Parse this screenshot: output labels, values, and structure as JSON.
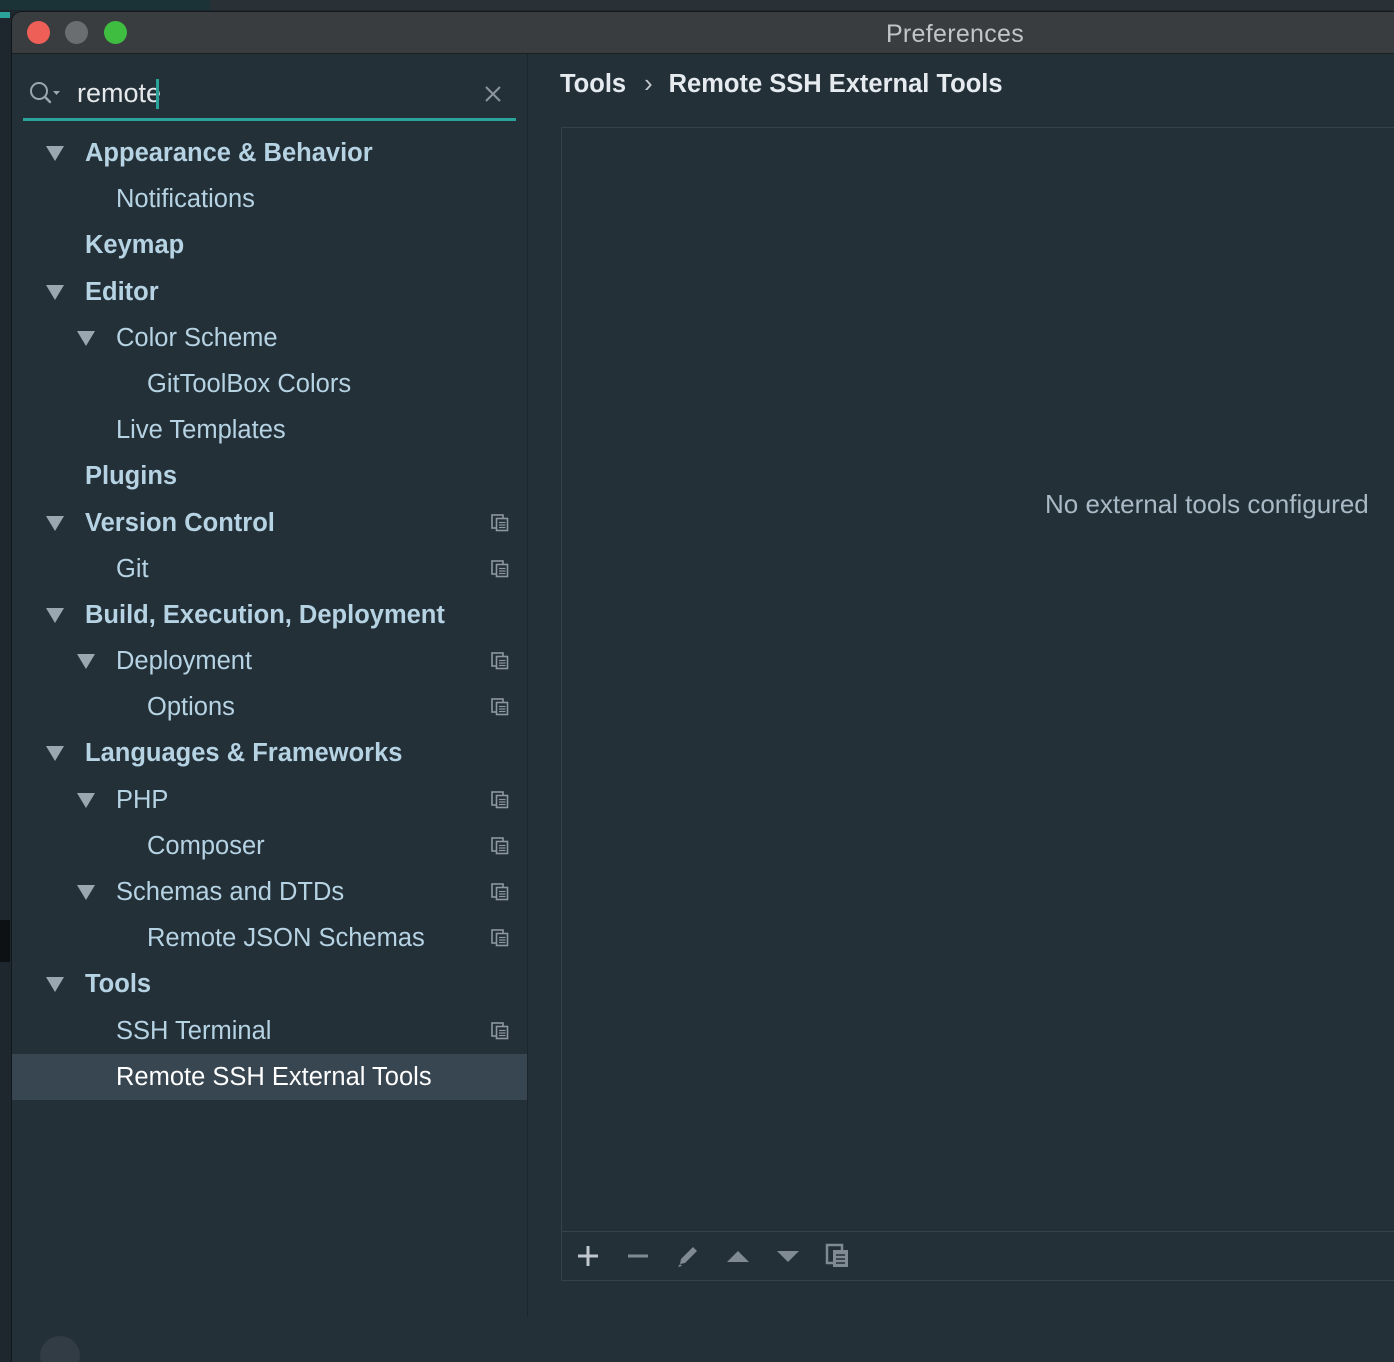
{
  "window": {
    "title": "Preferences"
  },
  "search": {
    "value": "remote",
    "placeholder": ""
  },
  "tree": [
    {
      "label": "Appearance & Behavior",
      "level": 0,
      "bold": true,
      "expanded": true,
      "copy": false,
      "selected": false
    },
    {
      "label": "Notifications",
      "level": 1,
      "bold": false,
      "expanded": null,
      "copy": false,
      "selected": false
    },
    {
      "label": "Keymap",
      "level": 0,
      "bold": true,
      "expanded": null,
      "copy": false,
      "selected": false
    },
    {
      "label": "Editor",
      "level": 0,
      "bold": true,
      "expanded": true,
      "copy": false,
      "selected": false
    },
    {
      "label": "Color Scheme",
      "level": 1,
      "bold": false,
      "expanded": true,
      "copy": false,
      "selected": false
    },
    {
      "label": "GitToolBox Colors",
      "level": 2,
      "bold": false,
      "expanded": null,
      "copy": false,
      "selected": false
    },
    {
      "label": "Live Templates",
      "level": 1,
      "bold": false,
      "expanded": null,
      "copy": false,
      "selected": false
    },
    {
      "label": "Plugins",
      "level": 0,
      "bold": true,
      "expanded": null,
      "copy": false,
      "selected": false
    },
    {
      "label": "Version Control",
      "level": 0,
      "bold": true,
      "expanded": true,
      "copy": true,
      "selected": false
    },
    {
      "label": "Git",
      "level": 1,
      "bold": false,
      "expanded": null,
      "copy": true,
      "selected": false
    },
    {
      "label": "Build, Execution, Deployment",
      "level": 0,
      "bold": true,
      "expanded": true,
      "copy": false,
      "selected": false
    },
    {
      "label": "Deployment",
      "level": 1,
      "bold": false,
      "expanded": true,
      "copy": true,
      "selected": false
    },
    {
      "label": "Options",
      "level": 2,
      "bold": false,
      "expanded": null,
      "copy": true,
      "selected": false
    },
    {
      "label": "Languages & Frameworks",
      "level": 0,
      "bold": true,
      "expanded": true,
      "copy": false,
      "selected": false
    },
    {
      "label": "PHP",
      "level": 1,
      "bold": false,
      "expanded": true,
      "copy": true,
      "selected": false
    },
    {
      "label": "Composer",
      "level": 2,
      "bold": false,
      "expanded": null,
      "copy": true,
      "selected": false
    },
    {
      "label": "Schemas and DTDs",
      "level": 1,
      "bold": false,
      "expanded": true,
      "copy": true,
      "selected": false
    },
    {
      "label": "Remote JSON Schemas",
      "level": 2,
      "bold": false,
      "expanded": null,
      "copy": true,
      "selected": false
    },
    {
      "label": "Tools",
      "level": 0,
      "bold": true,
      "expanded": true,
      "copy": false,
      "selected": false
    },
    {
      "label": "SSH Terminal",
      "level": 1,
      "bold": false,
      "expanded": null,
      "copy": true,
      "selected": false
    },
    {
      "label": "Remote SSH External Tools",
      "level": 1,
      "bold": false,
      "expanded": null,
      "copy": false,
      "selected": true
    }
  ],
  "breadcrumb": {
    "parent": "Tools",
    "separator": "›",
    "current": "Remote SSH External Tools"
  },
  "panel": {
    "empty_text": "No external tools configured"
  },
  "toolbar": {
    "buttons": [
      "add-icon",
      "remove-icon",
      "edit-icon",
      "move-up-icon",
      "move-down-icon",
      "copy-icon"
    ]
  },
  "colors": {
    "accent": "#2aa39a",
    "sidebar_text": "#b6d3e4",
    "selection": "#384651",
    "background": "#243038"
  }
}
